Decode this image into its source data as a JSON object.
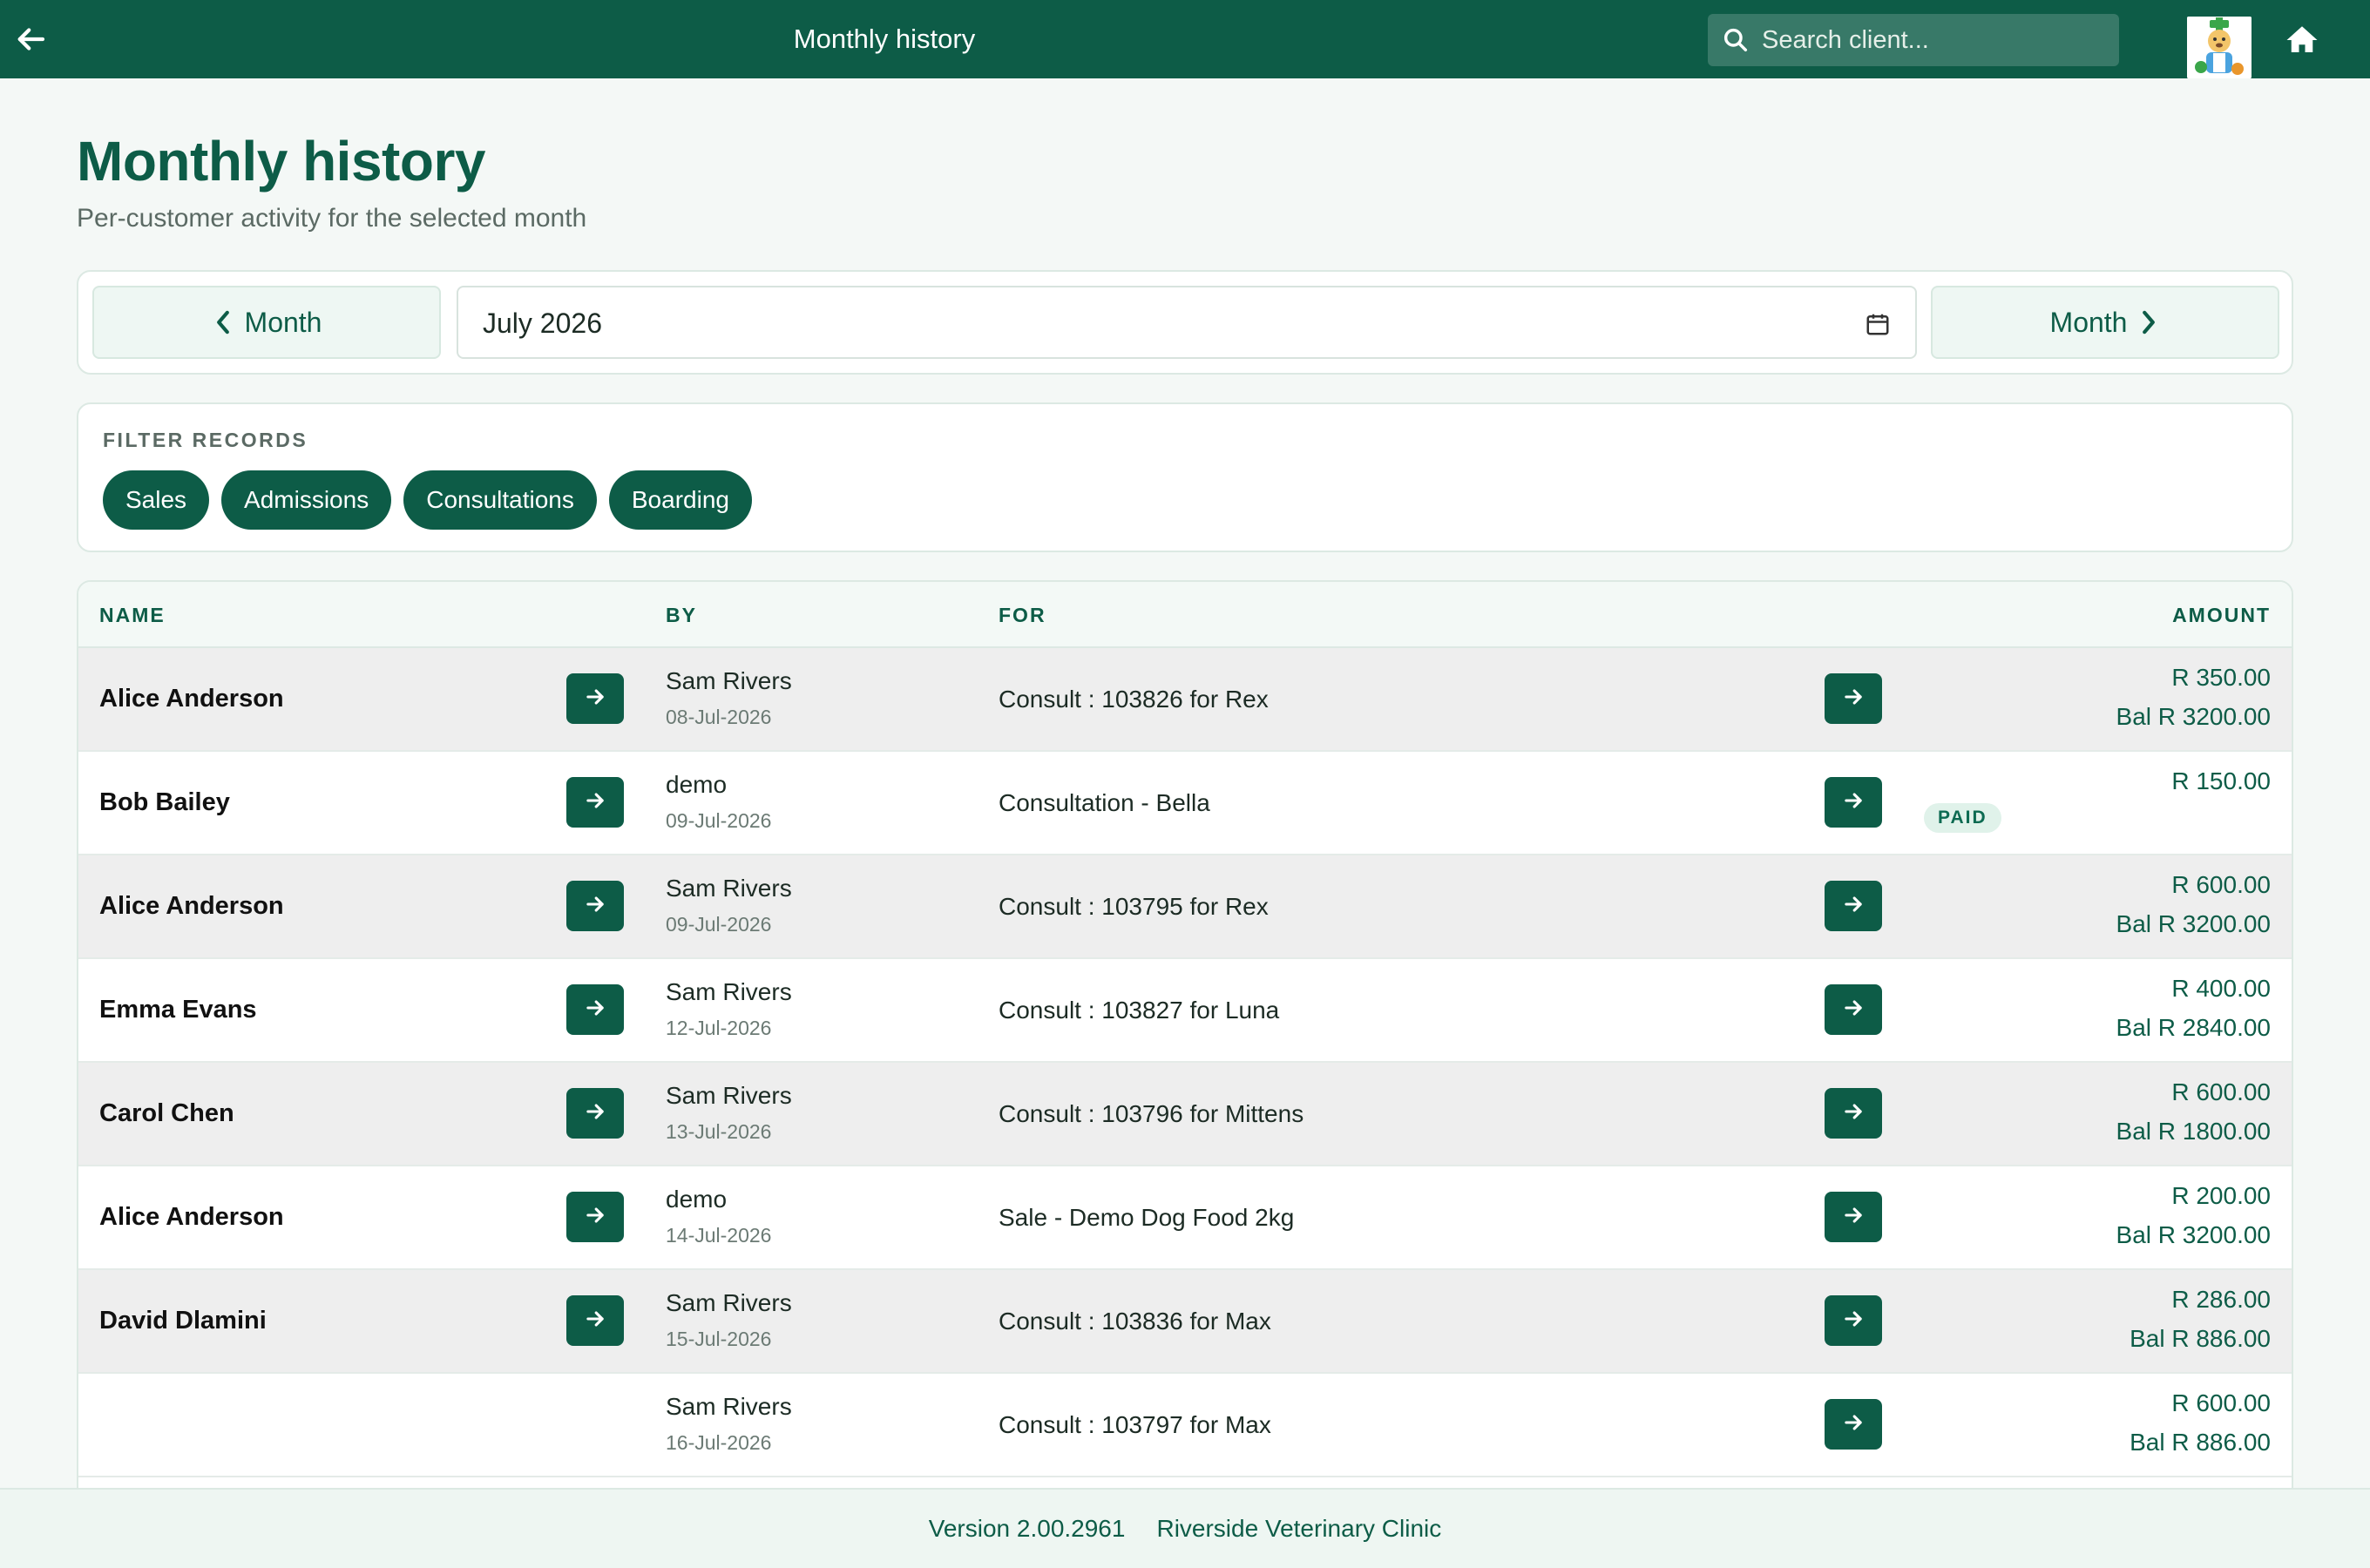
{
  "header": {
    "title": "Monthly history",
    "search_placeholder": "Search client...",
    "brand_color": "#0d5c47"
  },
  "page": {
    "title": "Monthly history",
    "subtitle": "Per-customer activity for the selected month"
  },
  "month_nav": {
    "prev_label": "Month",
    "next_label": "Month",
    "selected_month": "July 2026"
  },
  "filter": {
    "label": "FILTER RECORDS",
    "chips": [
      "Sales",
      "Admissions",
      "Consultations",
      "Boarding"
    ]
  },
  "table": {
    "columns": {
      "name": "NAME",
      "by": "BY",
      "for": "FOR",
      "amount": "AMOUNT"
    },
    "rows": [
      {
        "name": "Alice Anderson",
        "by": "Sam Rivers",
        "date": "08-Jul-2026",
        "for": "Consult : 103826 for Rex",
        "amount": "R 350.00",
        "balance": "Bal R 3200.00",
        "badge": ""
      },
      {
        "name": "Bob Bailey",
        "by": "demo",
        "date": "09-Jul-2026",
        "for": "Consultation - Bella",
        "amount": "R 150.00",
        "balance": "",
        "badge": "PAID"
      },
      {
        "name": "Alice Anderson",
        "by": "Sam Rivers",
        "date": "09-Jul-2026",
        "for": "Consult : 103795 for Rex",
        "amount": "R 600.00",
        "balance": "Bal R 3200.00",
        "badge": ""
      },
      {
        "name": "Emma Evans",
        "by": "Sam Rivers",
        "date": "12-Jul-2026",
        "for": "Consult : 103827 for Luna",
        "amount": "R 400.00",
        "balance": "Bal R 2840.00",
        "badge": ""
      },
      {
        "name": "Carol Chen",
        "by": "Sam Rivers",
        "date": "13-Jul-2026",
        "for": "Consult : 103796 for Mittens",
        "amount": "R 600.00",
        "balance": "Bal R 1800.00",
        "badge": ""
      },
      {
        "name": "Alice Anderson",
        "by": "demo",
        "date": "14-Jul-2026",
        "for": "Sale - Demo Dog Food 2kg",
        "amount": "R 200.00",
        "balance": "Bal R 3200.00",
        "badge": ""
      },
      {
        "name": "David Dlamini",
        "by": "Sam Rivers",
        "date": "15-Jul-2026",
        "for": "Consult : 103836 for Max",
        "amount": "R 286.00",
        "balance": "Bal R 886.00",
        "badge": ""
      },
      {
        "name": "",
        "by": "Sam Rivers",
        "date": "16-Jul-2026",
        "for": "Consult : 103797 for Max",
        "amount": "R 600.00",
        "balance": "Bal R 886.00",
        "badge": ""
      }
    ]
  },
  "footer": {
    "version": "Version 2.00.2961",
    "clinic": "Riverside Veterinary Clinic"
  }
}
